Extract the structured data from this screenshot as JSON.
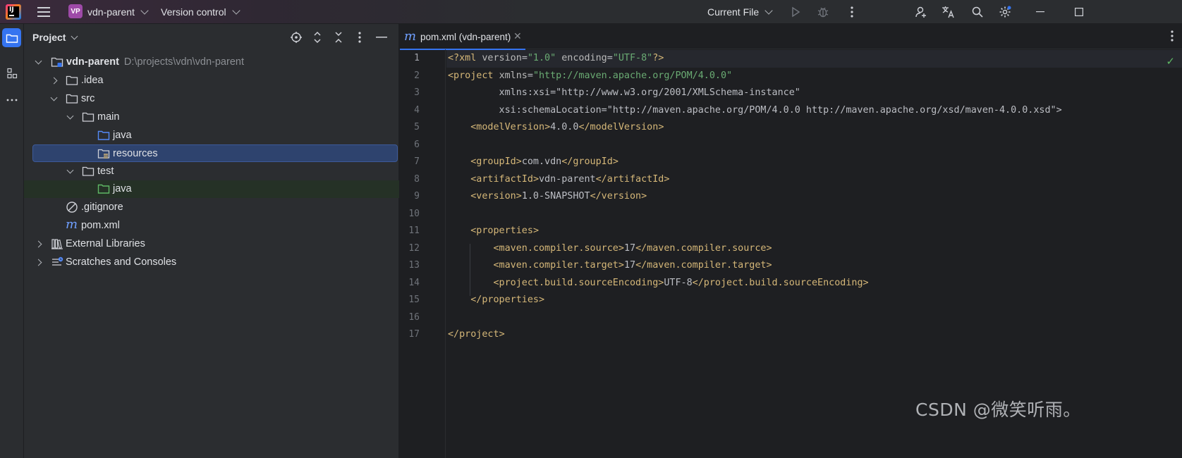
{
  "titlebar": {
    "app_icon": "intellij-idea-icon",
    "project_badge": "VP",
    "project_name": "vdn-parent",
    "version_control_label": "Version control",
    "run_config_label": "Current File"
  },
  "project_panel": {
    "title": "Project",
    "tree": [
      {
        "label": "vdn-parent",
        "path": "D:\\projects\\vdn\\vdn-parent"
      },
      {
        "label": ".idea"
      },
      {
        "label": "src"
      },
      {
        "label": "main"
      },
      {
        "label": "java"
      },
      {
        "label": "resources"
      },
      {
        "label": "test"
      },
      {
        "label": "java"
      },
      {
        "label": ".gitignore"
      },
      {
        "label": "pom.xml"
      },
      {
        "label": "External Libraries"
      },
      {
        "label": "Scratches and Consoles"
      }
    ]
  },
  "editor": {
    "tab_icon_letter": "m",
    "tab_label": "pom.xml (vdn-parent)",
    "line_numbers": [
      "1",
      "2",
      "3",
      "4",
      "5",
      "6",
      "7",
      "8",
      "9",
      "10",
      "11",
      "12",
      "13",
      "14",
      "15",
      "16",
      "17"
    ],
    "lines": [
      "<?xml version=\"1.0\" encoding=\"UTF-8\"?>",
      "<project xmlns=\"http://maven.apache.org/POM/4.0.0\"",
      "         xmlns:xsi=\"http://www.w3.org/2001/XMLSchema-instance\"",
      "         xsi:schemaLocation=\"http://maven.apache.org/POM/4.0.0 http://maven.apache.org/xsd/maven-4.0.0.xsd\">",
      "    <modelVersion>4.0.0</modelVersion>",
      "",
      "    <groupId>com.vdn</groupId>",
      "    <artifactId>vdn-parent</artifactId>",
      "    <version>1.0-SNAPSHOT</version>",
      "",
      "    <properties>",
      "        <maven.compiler.source>17</maven.compiler.source>",
      "        <maven.compiler.target>17</maven.compiler.target>",
      "        <project.build.sourceEncoding>UTF-8</project.build.sourceEncoding>",
      "    </properties>",
      "",
      "</project>"
    ]
  },
  "watermark": "CSDN @微笑听雨。",
  "colors": {
    "accent": "#3574f0",
    "selection": "#2e436e",
    "tag": "#d5b778",
    "string": "#6aab73",
    "namespace": "#c77dbb",
    "test_row": "#253126"
  }
}
